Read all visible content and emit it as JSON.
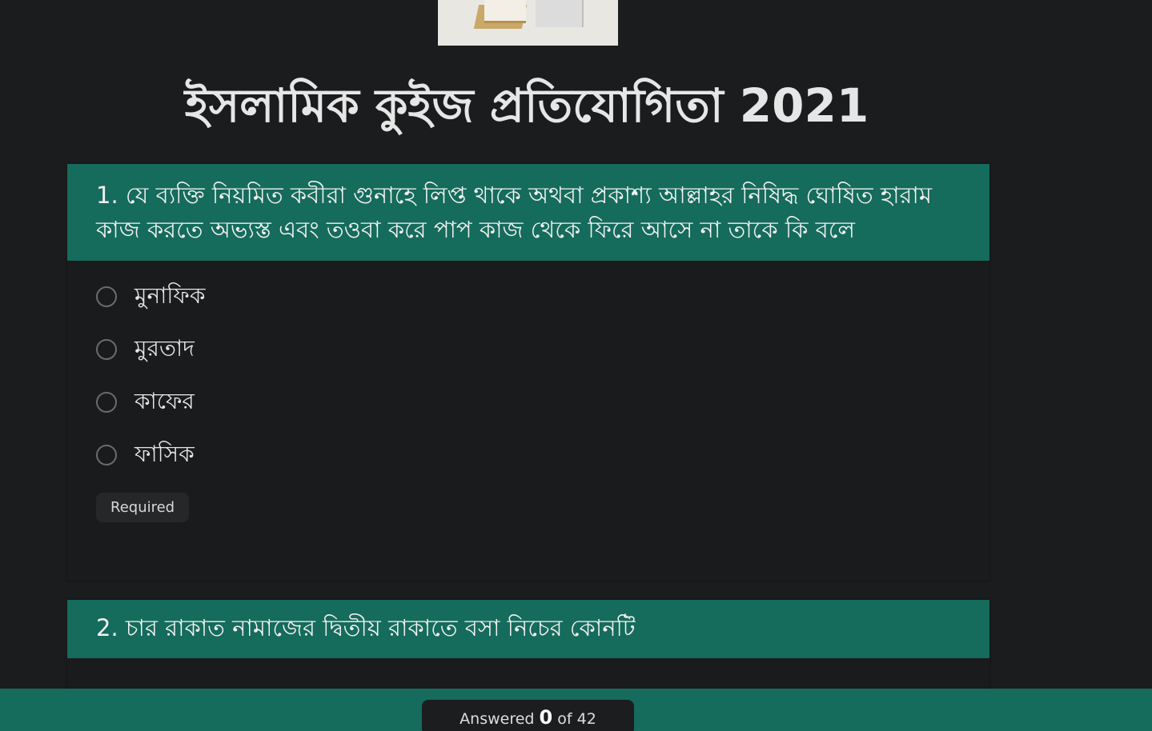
{
  "header": {
    "title": "ইসলামিক কুইজ প্রতিযোগিতা 2021"
  },
  "questions": [
    {
      "text": "1. যে ব্যক্তি নিয়মিত কবীরা গুনাহে লিপ্ত থাকে অথবা প্রকাশ্য আল্লাহর নিষিদ্ধ ঘোষিত হারাম কাজ করতে অভ্যস্ত এবং তওবা করে পাপ কাজ থেকে ফিরে আসে না তাকে কি বলে",
      "options": [
        "মুনাফিক",
        "মুরতাদ",
        "কাফের",
        "ফাসিক"
      ],
      "required_label": "Required"
    },
    {
      "text": "2. চার রাকাত নামাজের দ্বিতীয় রাকাতে বসা নিচের কোনটি"
    }
  ],
  "footer": {
    "answered_label": "Answered",
    "answered_count": "0",
    "of_label": "of 42"
  },
  "colors": {
    "background": "#1b1c1e",
    "accent": "#156b5c"
  }
}
